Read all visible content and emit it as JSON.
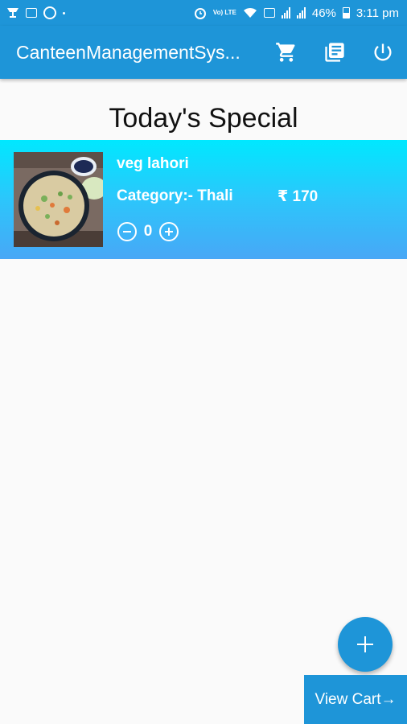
{
  "status_bar": {
    "battery": "46%",
    "time": "3:11 pm",
    "network_label": "Vo) LTE",
    "left_icons": [
      "download-icon",
      "sim-icon",
      "whatsapp-icon",
      "dot-icon"
    ],
    "right_icons": [
      "alarm-icon",
      "volte-icon",
      "wifi-icon",
      "data-icon",
      "signal-icon",
      "signal-icon",
      "battery-icon"
    ]
  },
  "app_bar": {
    "title": "CanteenManagementSys...",
    "actions": [
      "cart-icon",
      "orders-icon",
      "power-icon"
    ],
    "color": "#1e95d8"
  },
  "page": {
    "heading": "Today's Special"
  },
  "items": [
    {
      "name": "veg lahori",
      "category": "Category:- Thali",
      "price": "₹ 170",
      "quantity": "0"
    }
  ],
  "fab": {
    "icon": "plus-icon"
  },
  "view_cart": {
    "label": "View Cart→"
  }
}
